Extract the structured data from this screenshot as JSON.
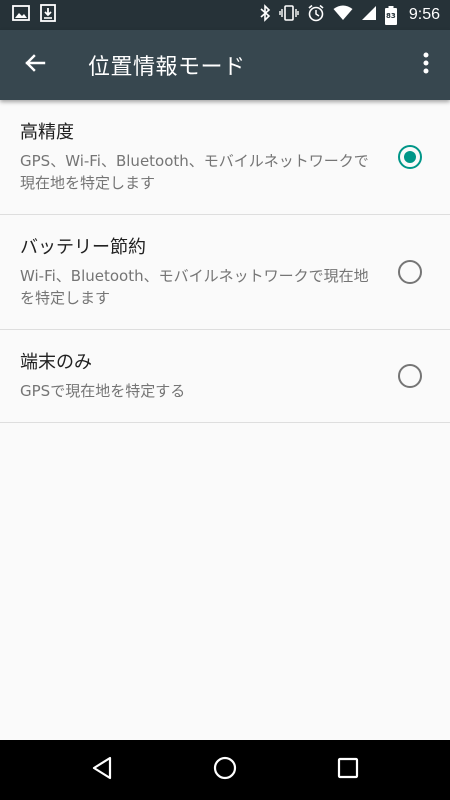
{
  "status_bar": {
    "time": "9:56",
    "battery_level": "83",
    "left_icons": [
      "image-icon",
      "download-icon"
    ],
    "right_icons": [
      "bluetooth-icon",
      "vibrate-icon",
      "alarm-icon",
      "wifi-icon",
      "signal-icon",
      "battery-icon"
    ]
  },
  "app_bar": {
    "title": "位置情報モード",
    "back_icon": "arrow-left-icon",
    "overflow_icon": "more-vert-icon"
  },
  "options": [
    {
      "title": "高精度",
      "description": "GPS、Wi-Fi、Bluetooth、モバイルネットワークで現在地を特定します",
      "selected": true
    },
    {
      "title": "バッテリー節約",
      "description": "Wi-Fi、Bluetooth、モバイルネットワークで現在地を特定します",
      "selected": false
    },
    {
      "title": "端末のみ",
      "description": "GPSで現在地を特定する",
      "selected": false
    }
  ],
  "nav_bar": {
    "icons": [
      "back-triangle-icon",
      "home-circle-icon",
      "recents-square-icon"
    ]
  },
  "colors": {
    "status_bar": "#263238",
    "app_bar": "#37474f",
    "accent": "#009688",
    "background": "#fafafa"
  }
}
